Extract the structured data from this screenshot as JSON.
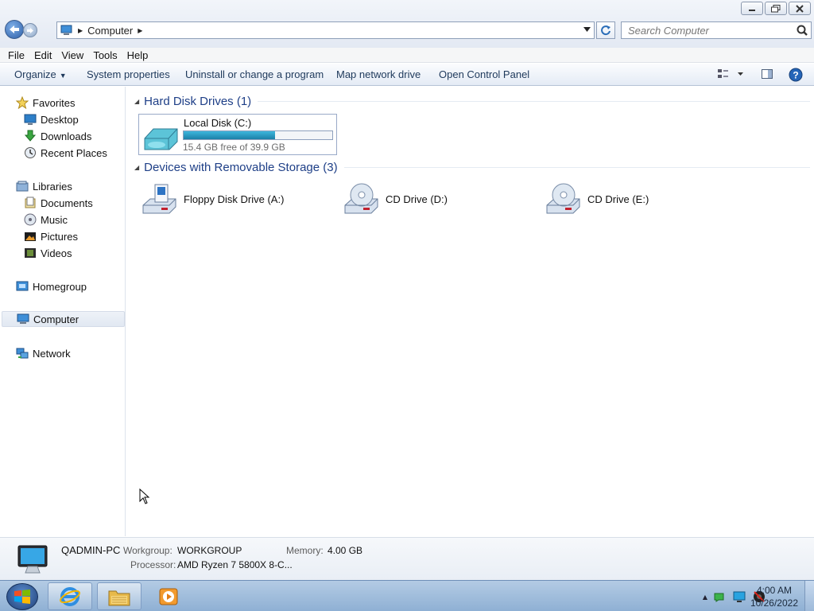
{
  "window": {
    "controls": {
      "minimize": "minimize",
      "restore": "restore",
      "close": "close"
    }
  },
  "address": {
    "crumbs": [
      "Computer"
    ],
    "search_placeholder": "Search Computer"
  },
  "menu": [
    "File",
    "Edit",
    "View",
    "Tools",
    "Help"
  ],
  "commands": {
    "organize": "Organize",
    "items": [
      "System properties",
      "Uninstall or change a program",
      "Map network drive",
      "Open Control Panel"
    ]
  },
  "nav": {
    "favorites": "Favorites",
    "favorites_items": [
      "Desktop",
      "Downloads",
      "Recent Places"
    ],
    "libraries": "Libraries",
    "libraries_items": [
      "Documents",
      "Music",
      "Pictures",
      "Videos"
    ],
    "homegroup": "Homegroup",
    "computer": "Computer",
    "network": "Network"
  },
  "content": {
    "hdd_group": "Hard Disk Drives (1)",
    "hdd": {
      "name": "Local Disk (C:)",
      "free_text": "15.4 GB free of 39.9 GB",
      "used_fraction": 0.614
    },
    "removable_group": "Devices with Removable Storage (3)",
    "devices": [
      "Floppy Disk Drive (A:)",
      "CD Drive (D:)",
      "CD Drive (E:)"
    ]
  },
  "details": {
    "pc_name": "QADMIN-PC",
    "workgroup_label": "Workgroup:",
    "workgroup_value": "WORKGROUP",
    "memory_label": "Memory:",
    "memory_value": "4.00 GB",
    "processor_label": "Processor:",
    "processor_value": "AMD Ryzen 7 5800X 8-C..."
  },
  "taskbar": {
    "time": "4:00 AM",
    "date": "10/26/2022"
  },
  "colors": {
    "accent": "#1e3f87",
    "progress": "#1b80a8"
  }
}
